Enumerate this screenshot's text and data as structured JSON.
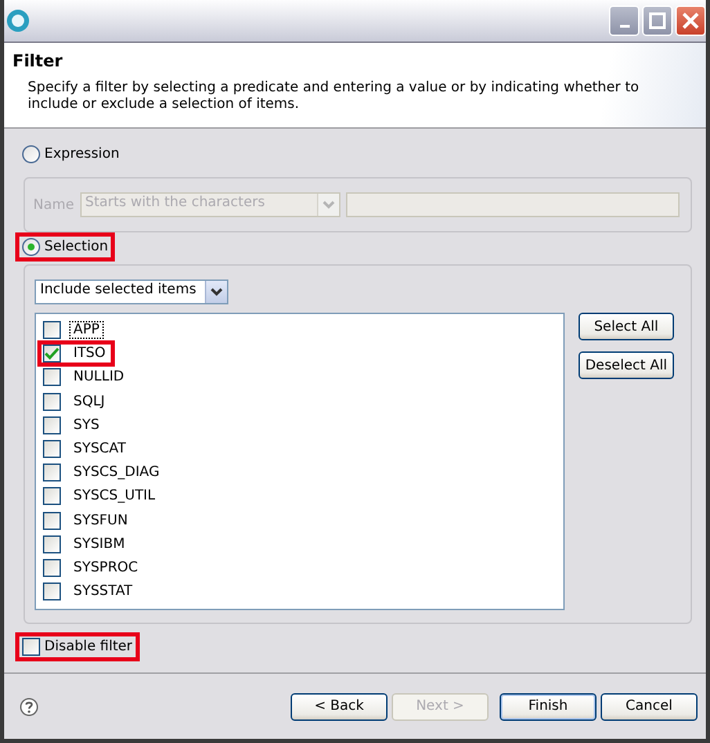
{
  "header": {
    "title": "Filter",
    "description": "Specify a filter by selecting a predicate and entering a value or by indicating whether to include or exclude a selection of items."
  },
  "modes": [
    {
      "label": "Expression",
      "selected": false,
      "highlighted": false
    },
    {
      "label": "Selection",
      "selected": true,
      "highlighted": true
    }
  ],
  "expression": {
    "disabled": true,
    "name_label": "Name",
    "predicate": "Starts with the characters"
  },
  "selection": {
    "mode": "Include selected items",
    "items": [
      {
        "label": "APP",
        "checked": false,
        "focused": true,
        "highlighted": false
      },
      {
        "label": "ITSO",
        "checked": true,
        "focused": false,
        "highlighted": true
      },
      {
        "label": "NULLID",
        "checked": false,
        "focused": false,
        "highlighted": false
      },
      {
        "label": "SQLJ",
        "checked": false,
        "focused": false,
        "highlighted": false
      },
      {
        "label": "SYS",
        "checked": false,
        "focused": false,
        "highlighted": false
      },
      {
        "label": "SYSCAT",
        "checked": false,
        "focused": false,
        "highlighted": false
      },
      {
        "label": "SYSCS_DIAG",
        "checked": false,
        "focused": false,
        "highlighted": false
      },
      {
        "label": "SYSCS_UTIL",
        "checked": false,
        "focused": false,
        "highlighted": false
      },
      {
        "label": "SYSFUN",
        "checked": false,
        "focused": false,
        "highlighted": false
      },
      {
        "label": "SYSIBM",
        "checked": false,
        "focused": false,
        "highlighted": false
      },
      {
        "label": "SYSPROC",
        "checked": false,
        "focused": false,
        "highlighted": false
      },
      {
        "label": "SYSSTAT",
        "checked": false,
        "focused": false,
        "highlighted": false
      }
    ],
    "buttons": [
      "Select All",
      "Deselect All"
    ]
  },
  "disable_filter": {
    "label": "Disable filter",
    "checked": false,
    "highlighted": true
  },
  "buttons": [
    {
      "label": "< Back",
      "disabled": false,
      "default": false
    },
    {
      "label": "Next >",
      "disabled": true,
      "default": false
    },
    {
      "label": "Finish",
      "disabled": false,
      "default": true
    },
    {
      "label": "Cancel",
      "disabled": false,
      "default": false
    }
  ]
}
